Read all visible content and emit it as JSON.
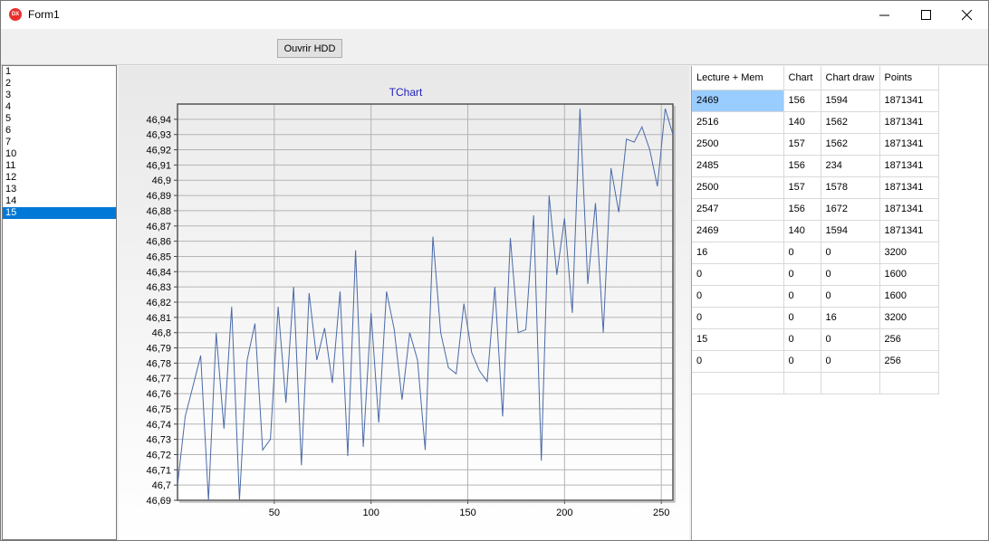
{
  "window": {
    "title": "Form1",
    "icon_text": "DX"
  },
  "toolbar": {
    "open_button": "Ouvrir HDD"
  },
  "listbox": {
    "items": [
      "1",
      "2",
      "3",
      "4",
      "5",
      "6",
      "7",
      "10",
      "11",
      "12",
      "13",
      "14",
      "15"
    ],
    "selected_index": 12
  },
  "chart_data": {
    "type": "line",
    "title": "TChart",
    "xlim": [
      0,
      256
    ],
    "ylim": [
      46.69,
      46.95
    ],
    "xticks": [
      50,
      100,
      150,
      200,
      250
    ],
    "yticks": [
      "46,69",
      "46,7",
      "46,71",
      "46,72",
      "46,73",
      "46,74",
      "46,75",
      "46,76",
      "46,77",
      "46,78",
      "46,79",
      "46,8",
      "46,81",
      "46,82",
      "46,83",
      "46,84",
      "46,85",
      "46,86",
      "46,87",
      "46,88",
      "46,89",
      "46,9",
      "46,91",
      "46,92",
      "46,93",
      "46,94"
    ],
    "grid": true,
    "series_color": "#4a6aa8",
    "series": [
      {
        "x": [
          0,
          4,
          8,
          12,
          16,
          20,
          24,
          28,
          32,
          36,
          40,
          44,
          48,
          52,
          56,
          60,
          64,
          68,
          72,
          76,
          80,
          84,
          88,
          92,
          96,
          100,
          104,
          108,
          112,
          116,
          120,
          124,
          128,
          132,
          136,
          140,
          144,
          148,
          152,
          156,
          160,
          164,
          168,
          172,
          176,
          180,
          184,
          188,
          192,
          196,
          200,
          204,
          208,
          212,
          216,
          220,
          224,
          228,
          232,
          236,
          240,
          244,
          248,
          252,
          256
        ],
        "y": [
          46.7,
          46.745,
          46.765,
          46.785,
          46.69,
          46.8,
          46.737,
          46.817,
          46.69,
          46.782,
          46.806,
          46.723,
          46.73,
          46.817,
          46.754,
          46.83,
          46.713,
          46.826,
          46.782,
          46.803,
          46.767,
          46.827,
          46.719,
          46.854,
          46.725,
          46.813,
          46.741,
          46.827,
          46.802,
          46.756,
          46.8,
          46.782,
          46.723,
          46.863,
          46.8,
          46.777,
          46.773,
          46.819,
          46.787,
          46.775,
          46.768,
          46.83,
          46.745,
          46.862,
          46.8,
          46.802,
          46.877,
          46.716,
          46.89,
          46.838,
          46.875,
          46.813,
          46.947,
          46.832,
          46.885,
          46.8,
          46.908,
          46.879,
          46.927,
          46.925,
          46.935,
          46.92,
          46.896,
          46.947,
          46.93
        ]
      }
    ]
  },
  "grid": {
    "columns": [
      "Lecture + Mem",
      "Chart",
      "Chart draw",
      "Points"
    ],
    "rows": [
      [
        "2469",
        "156",
        "1594",
        "1871341"
      ],
      [
        "2516",
        "140",
        "1562",
        "1871341"
      ],
      [
        "2500",
        "157",
        "1562",
        "1871341"
      ],
      [
        "2485",
        "156",
        "234",
        "1871341"
      ],
      [
        "2500",
        "157",
        "1578",
        "1871341"
      ],
      [
        "2547",
        "156",
        "1672",
        "1871341"
      ],
      [
        "2469",
        "140",
        "1594",
        "1871341"
      ],
      [
        "16",
        "0",
        "0",
        "3200"
      ],
      [
        "0",
        "0",
        "0",
        "1600"
      ],
      [
        "0",
        "0",
        "0",
        "1600"
      ],
      [
        "0",
        "0",
        "16",
        "3200"
      ],
      [
        "15",
        "0",
        "0",
        "256"
      ],
      [
        "0",
        "0",
        "0",
        "256"
      ],
      [
        "",
        "",
        "",
        ""
      ]
    ],
    "selected_cell": [
      0,
      0
    ],
    "selection_color": "#99ccff"
  }
}
